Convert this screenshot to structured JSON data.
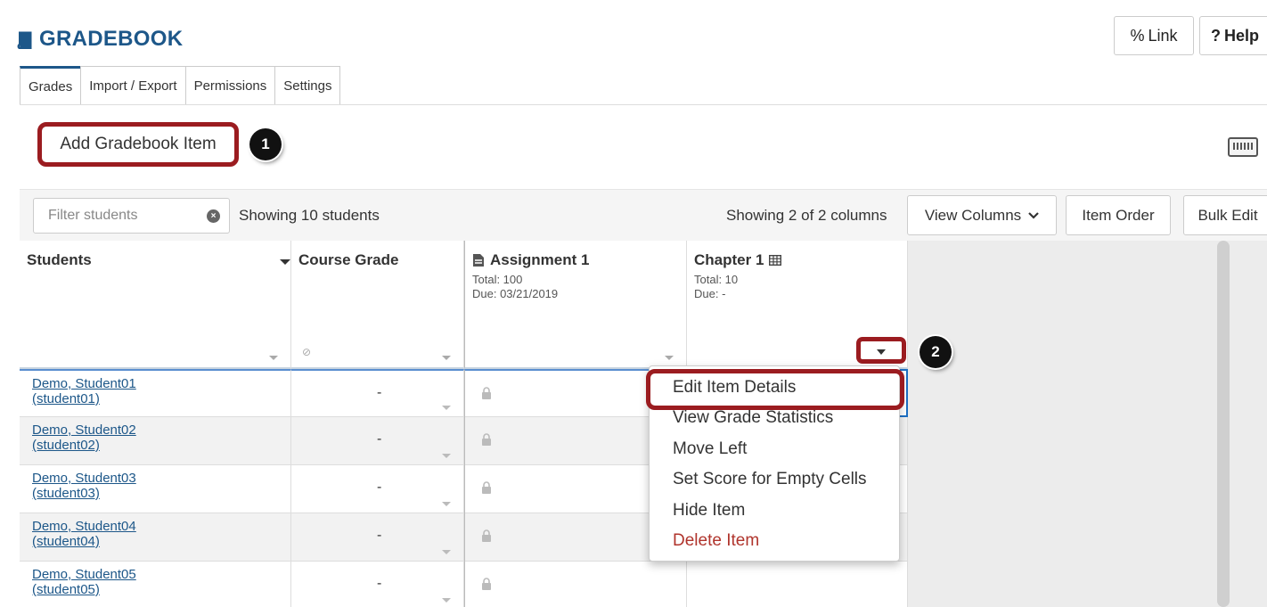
{
  "title": "GRADEBOOK",
  "header_buttons": {
    "link": "Link",
    "help": "Help"
  },
  "tabs": [
    "Grades",
    "Import / Export",
    "Permissions",
    "Settings"
  ],
  "add_item_label": "Add Gradebook Item",
  "callouts": [
    "1",
    "2"
  ],
  "toolbar": {
    "filter_placeholder": "Filter students",
    "showing_students": "Showing 10 students",
    "showing_columns": "Showing 2 of 2 columns",
    "view_columns": "View Columns",
    "item_order": "Item Order",
    "bulk_edit": "Bulk Edit"
  },
  "columns": {
    "students": "Students",
    "course_grade": "Course Grade",
    "assignment": {
      "name": "Assignment 1",
      "total": "Total: 100",
      "due": "Due: 03/21/2019"
    },
    "chapter": {
      "name": "Chapter 1",
      "total": "Total: 10",
      "due": "Due: -"
    }
  },
  "rows": [
    {
      "name": "Demo, Student01",
      "id": "(student01)",
      "course_grade": "-"
    },
    {
      "name": "Demo, Student02",
      "id": "(student02)",
      "course_grade": "-"
    },
    {
      "name": "Demo, Student03",
      "id": "(student03)",
      "course_grade": "-"
    },
    {
      "name": "Demo, Student04",
      "id": "(student04)",
      "course_grade": "-"
    },
    {
      "name": "Demo, Student05",
      "id": "(student05)",
      "course_grade": "-"
    }
  ],
  "menu": {
    "items": [
      "Edit Item Details",
      "View Grade Statistics",
      "Move Left",
      "Set Score for Empty Cells",
      "Hide Item",
      "Delete Item"
    ]
  },
  "colors": {
    "brand": "#1d5789",
    "callout_border": "#9b1c20",
    "danger": "#b0342c"
  },
  "icons": [
    "book-icon",
    "link-icon",
    "help-icon",
    "keyboard-icon",
    "clear-icon",
    "chevron-down-icon",
    "document-icon",
    "table-icon",
    "lock-icon",
    "eye-slash-icon"
  ]
}
